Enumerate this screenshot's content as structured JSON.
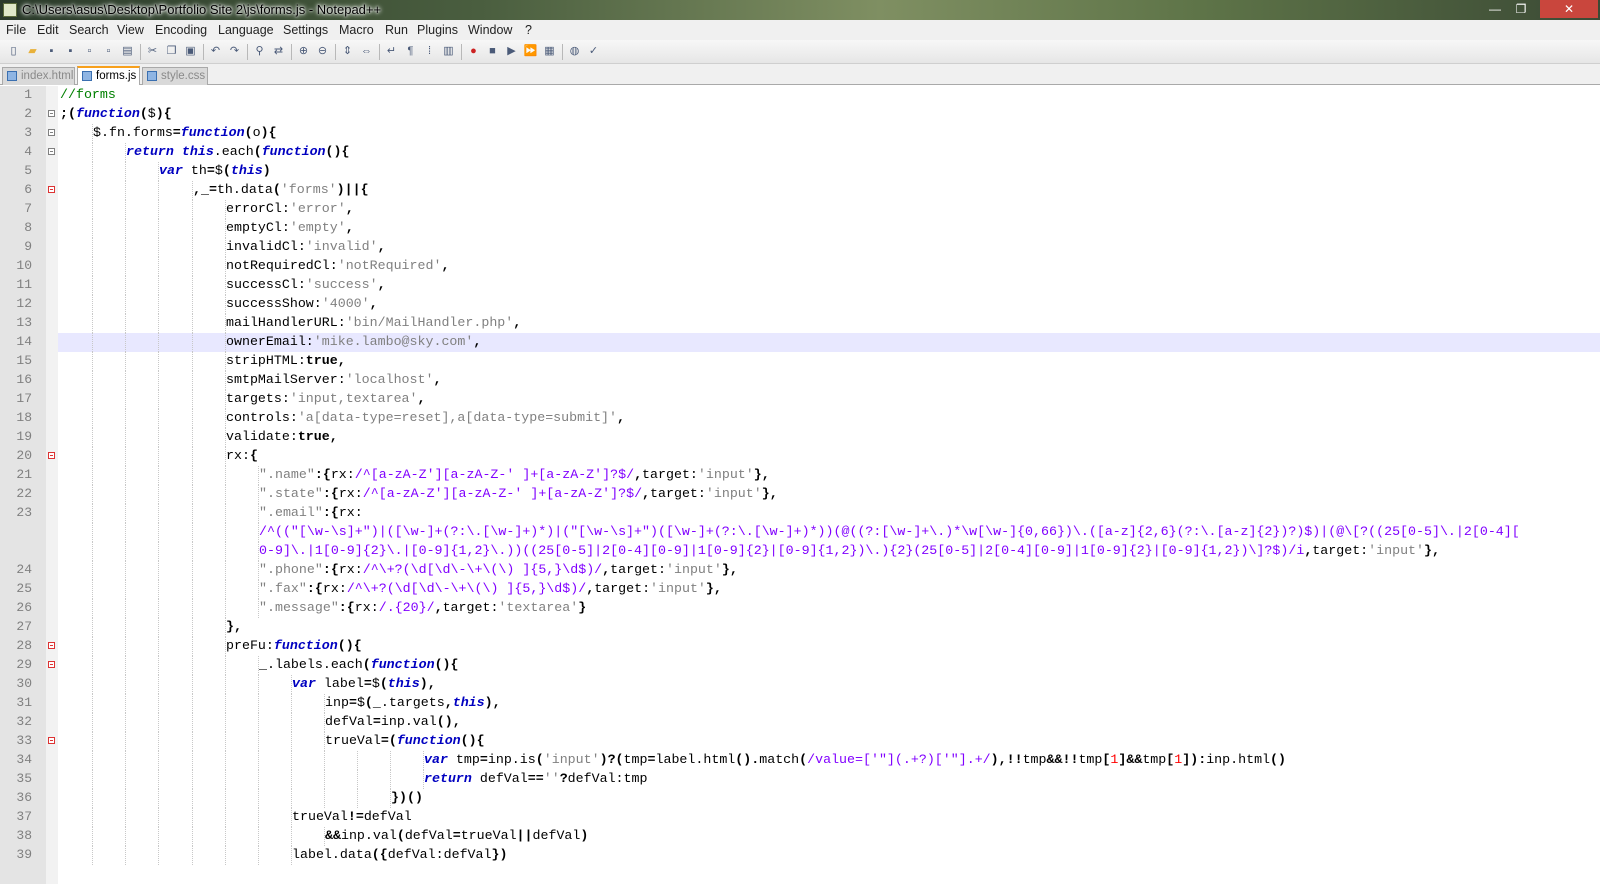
{
  "window": {
    "title": "C:\\Users\\asus\\Desktop\\Portfolio Site 2\\js\\forms.js - Notepad++",
    "controls": [
      "—",
      "❐",
      "✕"
    ]
  },
  "menu": [
    "File",
    "Edit",
    "Search",
    "View",
    "Encoding",
    "Language",
    "Settings",
    "Macro",
    "Run",
    "Plugins",
    "Window",
    "?"
  ],
  "toolbar": {
    "icons": [
      "new-file-icon",
      "open-file-icon",
      "save-icon",
      "save-all-icon",
      "close-icon",
      "close-all-icon",
      "print-icon",
      "cut-icon",
      "copy-icon",
      "paste-icon",
      "undo-icon",
      "redo-icon",
      "find-icon",
      "replace-icon",
      "zoom-in-icon",
      "zoom-out-icon",
      "sync-vertical-icon",
      "sync-horizontal-icon",
      "word-wrap-icon",
      "show-all-chars-icon",
      "indent-guide-icon",
      "document-map-icon",
      "record-macro-icon",
      "stop-record-icon",
      "play-macro-icon",
      "run-macro-multiple-icon",
      "save-macro-icon",
      "launch-browser-icon",
      "spellcheck-icon"
    ],
    "accent_record": "#cc2222",
    "accent_folder": "#e8b13a"
  },
  "tabs": [
    {
      "label": "index.html",
      "active": false
    },
    {
      "label": "forms.js",
      "active": true
    },
    {
      "label": "style.css",
      "active": false
    }
  ],
  "editor": {
    "current_line": 14,
    "highlight_color": "#e8e8ff",
    "lines": [
      {
        "n": "1",
        "fold": "",
        "indent": 0,
        "tokens": [
          [
            "cm",
            "//forms"
          ]
        ]
      },
      {
        "n": "2",
        "fold": "box",
        "indent": 0,
        "tokens": [
          [
            "op",
            ";("
          ],
          [
            "kw",
            "function"
          ],
          [
            "op",
            "("
          ],
          [
            "tx",
            "$"
          ],
          [
            "op",
            "){"
          ]
        ]
      },
      {
        "n": "3",
        "fold": "box",
        "indent": 1,
        "tokens": [
          [
            "tx",
            "$.fn.forms"
          ],
          [
            "op",
            "="
          ],
          [
            "kw",
            "function"
          ],
          [
            "op",
            "("
          ],
          [
            "tx",
            "o"
          ],
          [
            "op",
            "){"
          ]
        ]
      },
      {
        "n": "4",
        "fold": "box",
        "indent": 2,
        "tokens": [
          [
            "kw",
            "return"
          ],
          [
            "tx",
            " "
          ],
          [
            "kw",
            "this"
          ],
          [
            "tx",
            ".each"
          ],
          [
            "op",
            "("
          ],
          [
            "kw",
            "function"
          ],
          [
            "op",
            "(){"
          ]
        ]
      },
      {
        "n": "5",
        "fold": "",
        "indent": 3,
        "tokens": [
          [
            "kw",
            "var"
          ],
          [
            "tx",
            " th"
          ],
          [
            "op",
            "="
          ],
          [
            "tx",
            "$"
          ],
          [
            "op",
            "("
          ],
          [
            "kw",
            "this"
          ],
          [
            "op",
            ")"
          ]
        ]
      },
      {
        "n": "6",
        "fold": "red",
        "indent": 4,
        "tokens": [
          [
            "op",
            ","
          ],
          [
            "tx",
            "_"
          ],
          [
            "op",
            "="
          ],
          [
            "tx",
            "th.data"
          ],
          [
            "op",
            "("
          ],
          [
            "st",
            "'forms'"
          ],
          [
            "op",
            ")||{"
          ]
        ]
      },
      {
        "n": "7",
        "fold": "",
        "indent": 5,
        "tokens": [
          [
            "tx",
            "errorCl:"
          ],
          [
            "st",
            "'error'"
          ],
          [
            "op",
            ","
          ]
        ]
      },
      {
        "n": "8",
        "fold": "",
        "indent": 5,
        "tokens": [
          [
            "tx",
            "emptyCl:"
          ],
          [
            "st",
            "'empty'"
          ],
          [
            "op",
            ","
          ]
        ]
      },
      {
        "n": "9",
        "fold": "",
        "indent": 5,
        "tokens": [
          [
            "tx",
            "invalidCl:"
          ],
          [
            "st",
            "'invalid'"
          ],
          [
            "op",
            ","
          ]
        ]
      },
      {
        "n": "10",
        "fold": "",
        "indent": 5,
        "tokens": [
          [
            "tx",
            "notRequiredCl:"
          ],
          [
            "st",
            "'notRequired'"
          ],
          [
            "op",
            ","
          ]
        ]
      },
      {
        "n": "11",
        "fold": "",
        "indent": 5,
        "tokens": [
          [
            "tx",
            "successCl:"
          ],
          [
            "st",
            "'success'"
          ],
          [
            "op",
            ","
          ]
        ]
      },
      {
        "n": "12",
        "fold": "",
        "indent": 5,
        "tokens": [
          [
            "tx",
            "successShow:"
          ],
          [
            "st",
            "'4000'"
          ],
          [
            "op",
            ","
          ]
        ]
      },
      {
        "n": "13",
        "fold": "",
        "indent": 5,
        "tokens": [
          [
            "tx",
            "mailHandlerURL:"
          ],
          [
            "st",
            "'bin/MailHandler.php'"
          ],
          [
            "op",
            ","
          ]
        ]
      },
      {
        "n": "14",
        "fold": "",
        "indent": 5,
        "tokens": [
          [
            "tx",
            "ownerEmail:"
          ],
          [
            "st",
            "'mike.lambo@sky.com'"
          ],
          [
            "op",
            ","
          ]
        ]
      },
      {
        "n": "15",
        "fold": "",
        "indent": 5,
        "tokens": [
          [
            "tx",
            "stripHTML:"
          ],
          [
            "kwb",
            "true"
          ],
          [
            "op",
            ","
          ]
        ]
      },
      {
        "n": "16",
        "fold": "",
        "indent": 5,
        "tokens": [
          [
            "tx",
            "smtpMailServer:"
          ],
          [
            "st",
            "'localhost'"
          ],
          [
            "op",
            ","
          ]
        ]
      },
      {
        "n": "17",
        "fold": "",
        "indent": 5,
        "tokens": [
          [
            "tx",
            "targets:"
          ],
          [
            "st",
            "'input,textarea'"
          ],
          [
            "op",
            ","
          ]
        ]
      },
      {
        "n": "18",
        "fold": "",
        "indent": 5,
        "tokens": [
          [
            "tx",
            "controls:"
          ],
          [
            "st",
            "'a[data-type=reset],a[data-type=submit]'"
          ],
          [
            "op",
            ","
          ]
        ]
      },
      {
        "n": "19",
        "fold": "",
        "indent": 5,
        "tokens": [
          [
            "tx",
            "validate:"
          ],
          [
            "kwb",
            "true"
          ],
          [
            "op",
            ","
          ]
        ]
      },
      {
        "n": "20",
        "fold": "red",
        "indent": 5,
        "tokens": [
          [
            "tx",
            "rx:"
          ],
          [
            "op",
            "{"
          ]
        ]
      },
      {
        "n": "21",
        "fold": "",
        "indent": 6,
        "tokens": [
          [
            "st",
            "\".name\""
          ],
          [
            "op",
            ":{"
          ],
          [
            "tx",
            "rx:"
          ],
          [
            "re",
            "/^[a-zA-Z'][a-zA-Z-' ]+[a-zA-Z']?$/"
          ],
          [
            "op",
            ","
          ],
          [
            "tx",
            "target:"
          ],
          [
            "st",
            "'input'"
          ],
          [
            "op",
            "},"
          ]
        ]
      },
      {
        "n": "22",
        "fold": "",
        "indent": 6,
        "tokens": [
          [
            "st",
            "\".state\""
          ],
          [
            "op",
            ":{"
          ],
          [
            "tx",
            "rx:"
          ],
          [
            "re",
            "/^[a-zA-Z'][a-zA-Z-' ]+[a-zA-Z']?$/"
          ],
          [
            "op",
            ","
          ],
          [
            "tx",
            "target:"
          ],
          [
            "st",
            "'input'"
          ],
          [
            "op",
            "},"
          ]
        ]
      },
      {
        "n": "23",
        "fold": "",
        "indent": 6,
        "tokens": [
          [
            "st",
            "\".email\""
          ],
          [
            "op",
            ":{"
          ],
          [
            "tx",
            "rx:"
          ]
        ]
      },
      {
        "n": "",
        "fold": "",
        "indent": 6,
        "wrap": true,
        "tokens": [
          [
            "re",
            "/^((\"[\\w-\\s]+\")|([\\w-]+(?:\\.[\\w-]+)*)|(\"[\\w-\\s]+\")([\\w-]+(?:\\.[\\w-]+)*))(@((?:[\\w-]+\\.)*\\w[\\w-]{0,66})\\.([a-z]{2,6}(?:\\.[a-z]{2})?)$)|(@\\[?((25[0-5]\\.|2[0-4]["
          ]
        ]
      },
      {
        "n": "",
        "fold": "",
        "indent": 6,
        "wrap": true,
        "tokens": [
          [
            "re",
            "0-9]\\.|1[0-9]{2}\\.|[0-9]{1,2}\\.))((25[0-5]|2[0-4][0-9]|1[0-9]{2}|[0-9]{1,2})\\.){2}(25[0-5]|2[0-4][0-9]|1[0-9]{2}|[0-9]{1,2})\\]?$)/i"
          ],
          [
            "op",
            ","
          ],
          [
            "tx",
            "target:"
          ],
          [
            "st",
            "'input'"
          ],
          [
            "op",
            "},"
          ]
        ]
      },
      {
        "n": "24",
        "fold": "",
        "indent": 6,
        "tokens": [
          [
            "st",
            "\".phone\""
          ],
          [
            "op",
            ":{"
          ],
          [
            "tx",
            "rx:"
          ],
          [
            "re",
            "/^\\+?(\\d[\\d\\-\\+\\(\\) ]{5,}\\d$)/"
          ],
          [
            "op",
            ","
          ],
          [
            "tx",
            "target:"
          ],
          [
            "st",
            "'input'"
          ],
          [
            "op",
            "},"
          ]
        ]
      },
      {
        "n": "25",
        "fold": "",
        "indent": 6,
        "tokens": [
          [
            "st",
            "\".fax\""
          ],
          [
            "op",
            ":{"
          ],
          [
            "tx",
            "rx:"
          ],
          [
            "re",
            "/^\\+?(\\d[\\d\\-\\+\\(\\) ]{5,}\\d$)/"
          ],
          [
            "op",
            ","
          ],
          [
            "tx",
            "target:"
          ],
          [
            "st",
            "'input'"
          ],
          [
            "op",
            "},"
          ]
        ]
      },
      {
        "n": "26",
        "fold": "",
        "indent": 6,
        "tokens": [
          [
            "st",
            "\".message\""
          ],
          [
            "op",
            ":{"
          ],
          [
            "tx",
            "rx:"
          ],
          [
            "re",
            "/.{20}/"
          ],
          [
            "op",
            ","
          ],
          [
            "tx",
            "target:"
          ],
          [
            "st",
            "'textarea'"
          ],
          [
            "op",
            "}"
          ]
        ]
      },
      {
        "n": "27",
        "fold": "end",
        "indent": 5,
        "tokens": [
          [
            "op",
            "},"
          ]
        ]
      },
      {
        "n": "28",
        "fold": "red",
        "indent": 5,
        "tokens": [
          [
            "tx",
            "preFu:"
          ],
          [
            "kw",
            "function"
          ],
          [
            "op",
            "(){"
          ]
        ]
      },
      {
        "n": "29",
        "fold": "red",
        "indent": 6,
        "tokens": [
          [
            "tx",
            "_.labels.each"
          ],
          [
            "op",
            "("
          ],
          [
            "kw",
            "function"
          ],
          [
            "op",
            "(){"
          ]
        ]
      },
      {
        "n": "30",
        "fold": "",
        "indent": 7,
        "tokens": [
          [
            "kw",
            "var"
          ],
          [
            "tx",
            " label"
          ],
          [
            "op",
            "="
          ],
          [
            "tx",
            "$"
          ],
          [
            "op",
            "("
          ],
          [
            "kw",
            "this"
          ],
          [
            "op",
            "),"
          ]
        ]
      },
      {
        "n": "31",
        "fold": "",
        "indent": 8,
        "tokens": [
          [
            "tx",
            "inp"
          ],
          [
            "op",
            "="
          ],
          [
            "tx",
            "$"
          ],
          [
            "op",
            "("
          ],
          [
            "tx",
            "_.targets"
          ],
          [
            "op",
            ","
          ],
          [
            "kw",
            "this"
          ],
          [
            "op",
            "),"
          ]
        ]
      },
      {
        "n": "32",
        "fold": "",
        "indent": 8,
        "tokens": [
          [
            "tx",
            "defVal"
          ],
          [
            "op",
            "="
          ],
          [
            "tx",
            "inp.val"
          ],
          [
            "op",
            "(),"
          ]
        ]
      },
      {
        "n": "33",
        "fold": "red",
        "indent": 8,
        "tokens": [
          [
            "tx",
            "trueVal"
          ],
          [
            "op",
            "=("
          ],
          [
            "kw",
            "function"
          ],
          [
            "op",
            "(){"
          ]
        ]
      },
      {
        "n": "34",
        "fold": "",
        "indent": 11,
        "tokens": [
          [
            "kw",
            "var"
          ],
          [
            "tx",
            " tmp"
          ],
          [
            "op",
            "="
          ],
          [
            "tx",
            "inp.is"
          ],
          [
            "op",
            "("
          ],
          [
            "st",
            "'input'"
          ],
          [
            "op",
            ")?("
          ],
          [
            "tx",
            "tmp"
          ],
          [
            "op",
            "="
          ],
          [
            "tx",
            "label.html"
          ],
          [
            "op",
            "()."
          ],
          [
            "tx",
            "match"
          ],
          [
            "op",
            "("
          ],
          [
            "re",
            "/value=['\"](.+?)['\"].+/"
          ],
          [
            "op",
            "),!!"
          ],
          [
            "tx",
            "tmp"
          ],
          [
            "op",
            "&&!!"
          ],
          [
            "tx",
            "tmp"
          ],
          [
            "op",
            "["
          ],
          [
            "num",
            "1"
          ],
          [
            "op",
            "]&&"
          ],
          [
            "tx",
            "tmp"
          ],
          [
            "op",
            "["
          ],
          [
            "num",
            "1"
          ],
          [
            "op",
            "]):"
          ],
          [
            "tx",
            "inp.html"
          ],
          [
            "op",
            "()"
          ]
        ]
      },
      {
        "n": "35",
        "fold": "",
        "indent": 11,
        "tokens": [
          [
            "kw",
            "return"
          ],
          [
            "tx",
            " defVal"
          ],
          [
            "op",
            "=="
          ],
          [
            "st",
            "''"
          ],
          [
            "op",
            "?"
          ],
          [
            "tx",
            "defVal:tmp"
          ]
        ]
      },
      {
        "n": "36",
        "fold": "end",
        "indent": 10,
        "tokens": [
          [
            "op",
            "})()"
          ]
        ]
      },
      {
        "n": "37",
        "fold": "",
        "indent": 7,
        "tokens": [
          [
            "tx",
            "trueVal"
          ],
          [
            "op",
            "!="
          ],
          [
            "tx",
            "defVal"
          ]
        ]
      },
      {
        "n": "38",
        "fold": "",
        "indent": 8,
        "tokens": [
          [
            "op",
            "&&"
          ],
          [
            "tx",
            "inp.val"
          ],
          [
            "op",
            "("
          ],
          [
            "tx",
            "defVal"
          ],
          [
            "op",
            "="
          ],
          [
            "tx",
            "trueVal"
          ],
          [
            "op",
            "||"
          ],
          [
            "tx",
            "defVal"
          ],
          [
            "op",
            ")"
          ]
        ]
      },
      {
        "n": "39",
        "fold": "",
        "indent": 7,
        "tokens": [
          [
            "tx",
            "label.data"
          ],
          [
            "op",
            "({"
          ],
          [
            "tx",
            "defVal:defVal"
          ],
          [
            "op",
            "})"
          ]
        ]
      }
    ]
  }
}
